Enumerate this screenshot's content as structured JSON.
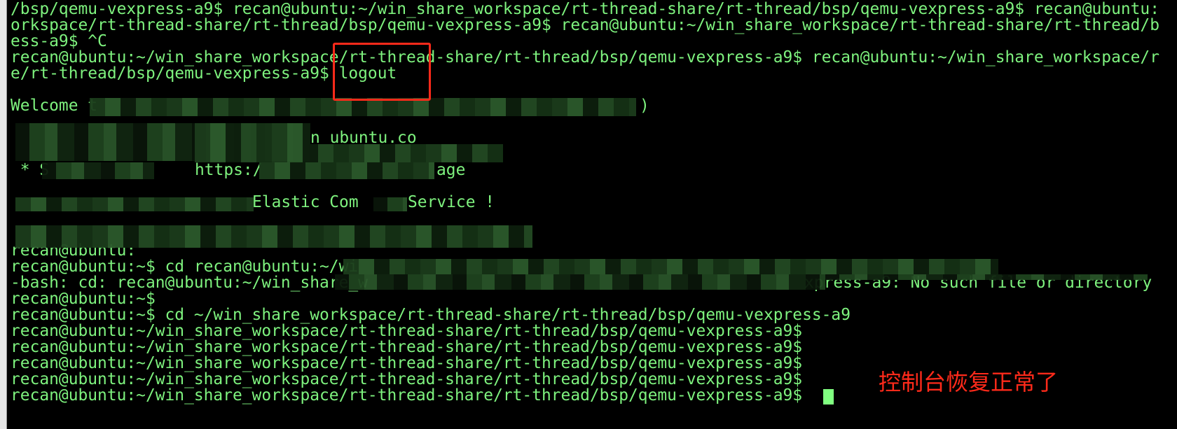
{
  "terminal": {
    "lines": [
      "/bsp/qemu-vexpress-a9$ recan@ubuntu:~/win_share_workspace/rt-thread-share/rt-thread/bsp/qemu-vexpress-a9$ recan@ubuntu:",
      "orkspace/rt-thread-share/rt-thread/bsp/qemu-vexpress-a9$ recan@ubuntu:~/win_share_workspace/rt-thread-share/rt-thread/b",
      "ess-a9$ ^C",
      "recan@ubuntu:~/win_share_workspace/rt-thread-share/rt-thread/bsp/qemu-vexpress-a9$ recan@ubuntu:~/win_share_workspace/r",
      "e/rt-thread/bsp/qemu-vexpress-a9$ logout"
    ],
    "welcome_start": "Welcome t",
    "welcome_end": ")",
    "ubuntu_fragment": "n ubuntu.co",
    "support_star": " * S",
    "https_fragment": "https:/",
    "age_fragment": "age",
    "elastic_fragment": "Elastic Com",
    "service_fragment": "Service !",
    "redacted_prompt": "recan@ubuntu:",
    "cd_bad": "recan@ubuntu:~$ cd recan@ubuntu:~/wi",
    "bash_error_start": "-bash: cd: recan@ubuntu:~/win_share_w",
    "bash_error_end": "xpress-a9: No such file or directory",
    "home_prompt": "recan@ubuntu:~$",
    "cd_good": "recan@ubuntu:~$ cd ~/win_share_workspace/rt-thread-share/rt-thread/bsp/qemu-vexpress-a9",
    "prompts": [
      "recan@ubuntu:~/win_share_workspace/rt-thread-share/rt-thread/bsp/qemu-vexpress-a9$",
      "recan@ubuntu:~/win_share_workspace/rt-thread-share/rt-thread/bsp/qemu-vexpress-a9$",
      "recan@ubuntu:~/win_share_workspace/rt-thread-share/rt-thread/bsp/qemu-vexpress-a9$",
      "recan@ubuntu:~/win_share_workspace/rt-thread-share/rt-thread/bsp/qemu-vexpress-a9$",
      "recan@ubuntu:~/win_share_workspace/rt-thread-share/rt-thread/bsp/qemu-vexpress-a9$"
    ],
    "text_color": "#7ef27e",
    "background": "#000000"
  },
  "annotation": {
    "note": "控制台恢复正常了",
    "color": "#ff2a1a"
  }
}
